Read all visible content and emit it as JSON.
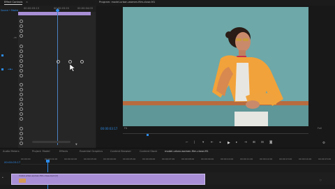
{
  "effect_controls": {
    "tab_label": "Effect Controls",
    "header_label": "Source • Master",
    "timecodes": [
      "00:00:03:13",
      "00:00:03:20",
      "00:00:04:03"
    ],
    "value_label": "-35",
    "bottom_timecode": "00:00:03:17"
  },
  "program_monitor": {
    "tab_label": "Program: model-urban-women-film-close-M1",
    "timecode": "00:00:03:17",
    "fit_label": "Fit",
    "quality_label": "Full",
    "duration": "00:00:09:05"
  },
  "timeline": {
    "tabs": [
      "Audio Meters",
      "Project: Model",
      "Effects",
      "Essential Graphics",
      "Content Browser",
      "Content Stock",
      "model-urban-women-film-close-M1"
    ],
    "timecode": "00:00:03:17",
    "ruler": [
      "00:00:00",
      "00:00:01:00",
      "00:00:02:00",
      "00:00:03:00",
      "00:00:04:00",
      "00:00:05:00",
      "00:00:06:00",
      "00:00:07:00",
      "00:00:08:00",
      "00:00:09:00",
      "00:00:10:00",
      "00:00:11:00",
      "00:00:12:00",
      "00:00:13:00",
      "00:00:14:00",
      "00:00:15:00",
      "00:00:16:00"
    ],
    "clip_label": "model-urban-women-film-close.mp4 [V]",
    "clip_color": "#a88fd6"
  },
  "colors": {
    "accent": "#2d8ceb",
    "clip": "#a88fd6"
  }
}
